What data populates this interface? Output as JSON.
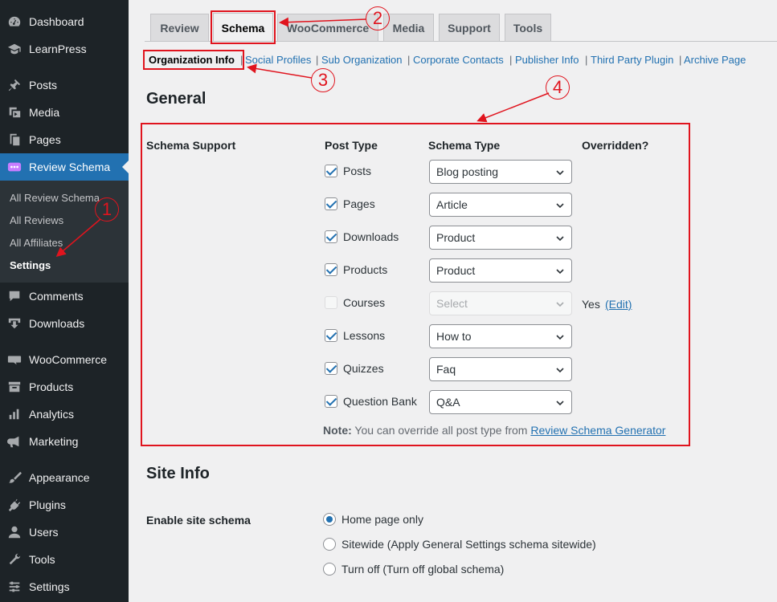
{
  "sidebar": {
    "items": [
      {
        "label": "Dashboard",
        "icon": "dashboard-icon"
      },
      {
        "label": "LearnPress",
        "icon": "graduation-cap-icon"
      },
      {
        "label": "Posts",
        "icon": "pin-icon"
      },
      {
        "label": "Media",
        "icon": "media-icon"
      },
      {
        "label": "Pages",
        "icon": "pages-icon"
      },
      {
        "label": "Review Schema",
        "icon": "review-schema-icon"
      },
      {
        "label": "Comments",
        "icon": "comment-icon"
      },
      {
        "label": "Downloads",
        "icon": "download-icon"
      },
      {
        "label": "WooCommerce",
        "icon": "woo-icon"
      },
      {
        "label": "Products",
        "icon": "archive-icon"
      },
      {
        "label": "Analytics",
        "icon": "bar-chart-icon"
      },
      {
        "label": "Marketing",
        "icon": "megaphone-icon"
      },
      {
        "label": "Appearance",
        "icon": "brush-icon"
      },
      {
        "label": "Plugins",
        "icon": "plug-icon"
      },
      {
        "label": "Users",
        "icon": "user-icon"
      },
      {
        "label": "Tools",
        "icon": "wrench-icon"
      },
      {
        "label": "Settings",
        "icon": "settings-icon"
      }
    ],
    "submenu": [
      "All Review Schema",
      "All Reviews",
      "All Affiliates",
      "Settings"
    ]
  },
  "tabs": [
    "Review",
    "Schema",
    "WooCommerce",
    "Media",
    "Support",
    "Tools"
  ],
  "subtabs": [
    "Organization Info",
    "Social Profiles",
    "Sub Organization",
    "Corporate Contacts",
    "Publisher Info",
    "Third Party Plugin",
    "Archive Page"
  ],
  "separator": "|",
  "general": {
    "title": "General",
    "schema_support_label": "Schema Support",
    "columns": {
      "post_type": "Post Type",
      "schema_type": "Schema Type",
      "overridden": "Overridden?"
    },
    "rows": [
      {
        "post_type": "Posts",
        "checked": true,
        "schema": "Blog posting"
      },
      {
        "post_type": "Pages",
        "checked": true,
        "schema": "Article"
      },
      {
        "post_type": "Downloads",
        "checked": true,
        "schema": "Product"
      },
      {
        "post_type": "Products",
        "checked": true,
        "schema": "Product"
      },
      {
        "post_type": "Courses",
        "checked": false,
        "schema": "Select",
        "overridden": "Yes",
        "edit": "(Edit)"
      },
      {
        "post_type": "Lessons",
        "checked": true,
        "schema": "How to"
      },
      {
        "post_type": "Quizzes",
        "checked": true,
        "schema": "Faq"
      },
      {
        "post_type": "Question Bank",
        "checked": true,
        "schema": "Q&A"
      }
    ],
    "note_label": "Note:",
    "note_text": "You can override all post type from",
    "note_link": "Review Schema Generator"
  },
  "site_info": {
    "title": "Site Info",
    "enable_label": "Enable site schema",
    "options": [
      "Home page only",
      "Sitewide (Apply General Settings schema sitewide)",
      "Turn off (Turn off global schema)"
    ],
    "selected": 0
  },
  "annotations": [
    "1",
    "2",
    "3",
    "4"
  ],
  "colors": {
    "accent": "#2271b1",
    "annotation": "#e0141e",
    "sidebar": "#1d2327"
  }
}
